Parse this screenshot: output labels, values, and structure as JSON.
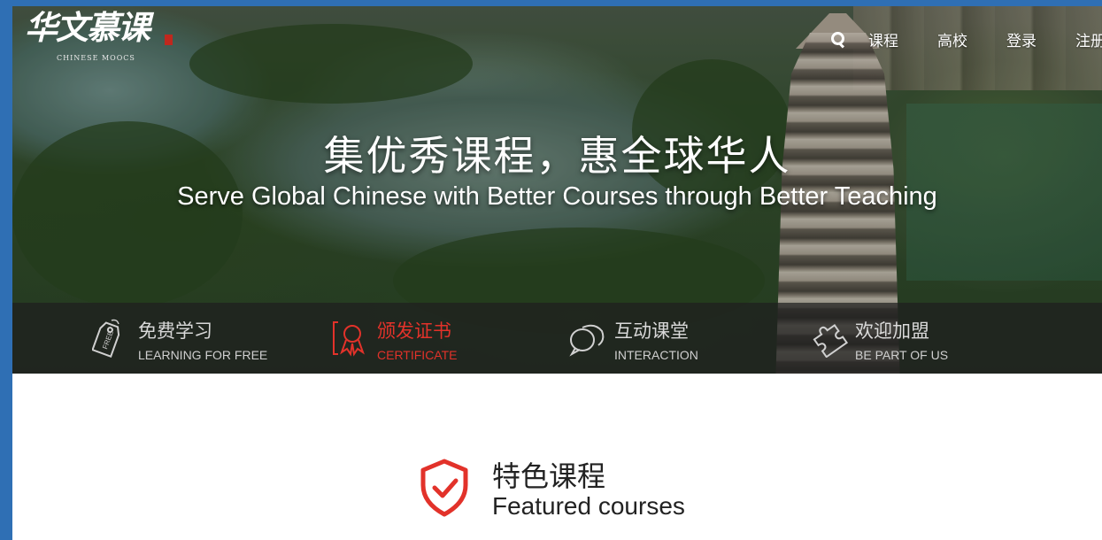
{
  "brand": {
    "logo_text": "华文慕课",
    "logo_subtitle": "CHINESE MOOCS"
  },
  "nav": {
    "search_icon": "search-icon",
    "items": [
      {
        "label": "课程"
      },
      {
        "label": "高校"
      },
      {
        "label": "登录"
      },
      {
        "label": "注册"
      }
    ]
  },
  "hero": {
    "slogan_cn": "集优秀课程，惠全球华人",
    "slogan_en": "Serve Global Chinese with Better Courses through Better Teaching"
  },
  "features": [
    {
      "title": "免费学习",
      "subtitle": "LEARNING FOR FREE",
      "icon": "free-tag-icon",
      "active": false
    },
    {
      "title": "颁发证书",
      "subtitle": "CERTIFICATE",
      "icon": "certificate-icon",
      "active": true
    },
    {
      "title": "互动课堂",
      "subtitle": "INTERACTION",
      "icon": "chat-bubbles-icon",
      "active": false
    },
    {
      "title": "欢迎加盟",
      "subtitle": "BE PART OF US",
      "icon": "puzzle-icon",
      "active": false
    }
  ],
  "featured": {
    "icon": "shield-check-icon",
    "title_cn": "特色课程",
    "title_en": "Featured courses"
  },
  "colors": {
    "accent": "#e2322a",
    "window_frame": "#2f6fb4",
    "feature_bar": "#1e1e1e"
  }
}
